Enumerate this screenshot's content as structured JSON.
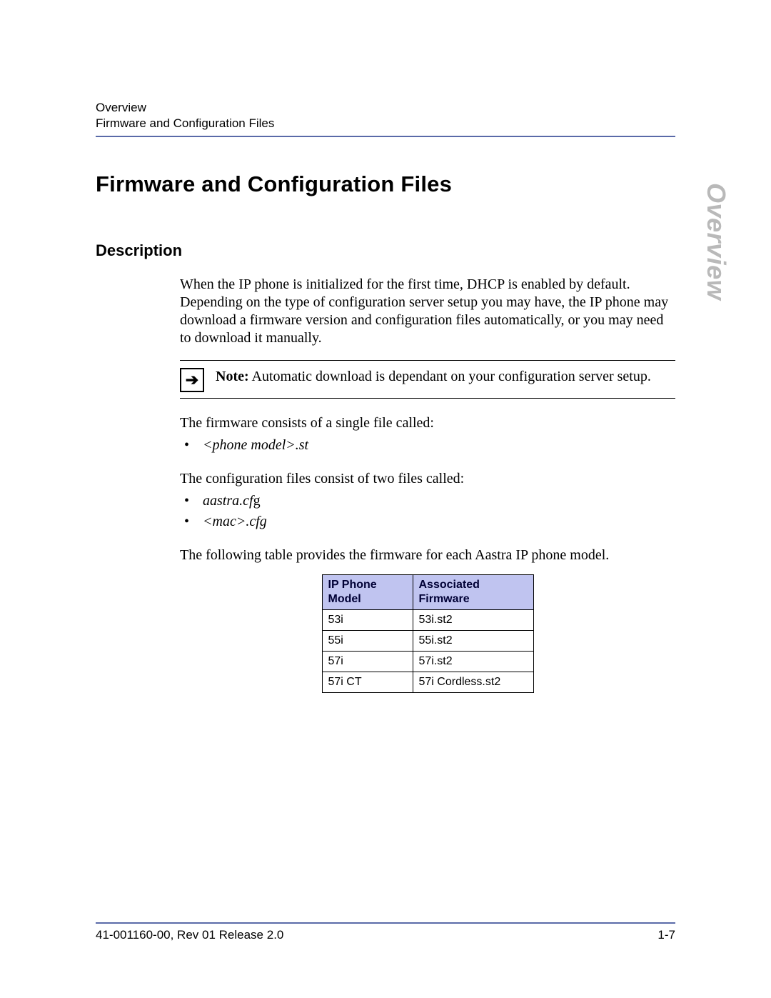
{
  "header": {
    "section": "Overview",
    "subsection": "Firmware and Configuration Files"
  },
  "side_tab": "Overview",
  "title": "Firmware and Configuration Files",
  "section_heading": "Description",
  "intro_paragraph": "When the IP phone is initialized for the first time, DHCP is enabled by default. Depending on the type of configuration server setup you may have, the IP phone may download a firmware version and configuration files automatically, or you may need to download it manually.",
  "note": {
    "label": "Note:",
    "text": "Automatic download is dependant on your configuration server setup."
  },
  "firmware_intro": "The firmware consists of a single file called:",
  "firmware_bullets": [
    "<phone model>.st"
  ],
  "config_intro": "The configuration files consist of two files called:",
  "config_bullets_italic": [
    "aastra.cf",
    "<mac>.cfg"
  ],
  "config_bullet0_trailing": "g",
  "table_intro": "The following table provides the firmware for each Aastra IP phone model.",
  "table": {
    "col_a": "IP Phone Model",
    "col_b": "Associated Firmware",
    "rows": [
      {
        "model": "53i",
        "fw": "53i.st2"
      },
      {
        "model": "55i",
        "fw": "55i.st2"
      },
      {
        "model": "57i",
        "fw": "57i.st2"
      },
      {
        "model": "57i CT",
        "fw": "57i Cordless.st2"
      }
    ]
  },
  "footer": {
    "left": "41-001160-00, Rev 01  Release 2.0",
    "right": "1-7"
  }
}
